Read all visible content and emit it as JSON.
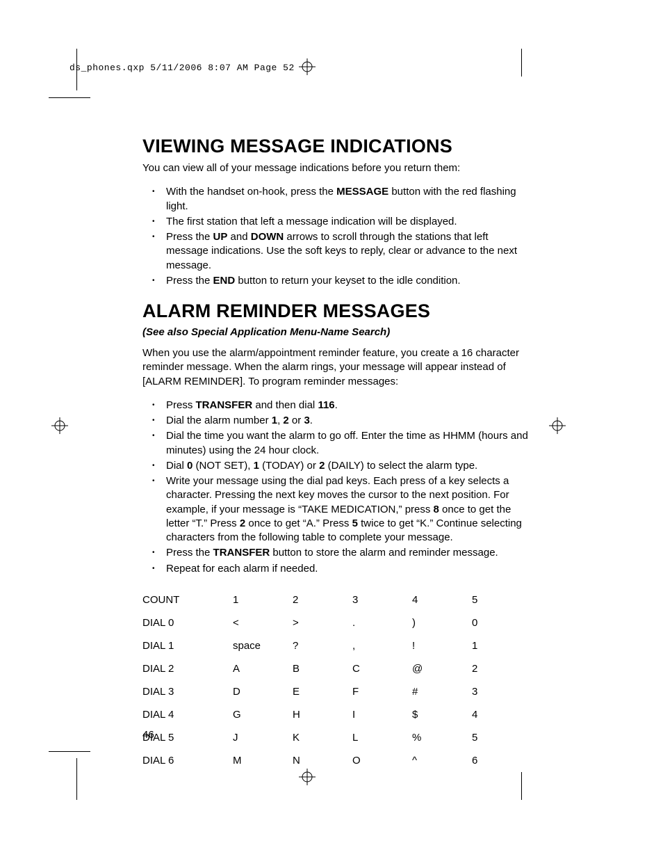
{
  "header_line": "ds_phones.qxp  5/11/2006  8:07 AM  Page 52",
  "section1": {
    "title": "VIEWING MESSAGE INDICATIONS",
    "intro": "You can view all of your message indications before you return them:",
    "bullets": [
      {
        "pre": "With the handset on-hook, press the ",
        "b1": "MESSAGE",
        "post": " button with the red flashing light."
      },
      {
        "pre": "The first station that left a message indication will be displayed."
      },
      {
        "pre": "Press the ",
        "b1": "UP",
        "mid1": " and ",
        "b2": "DOWN",
        "post": " arrows to scroll through the stations that left message indications. Use the soft keys to reply, clear or advance to the next message."
      },
      {
        "pre": "Press the ",
        "b1": "END",
        "post": " button to return your keyset to the idle condition."
      }
    ]
  },
  "section2": {
    "title": "ALARM REMINDER MESSAGES",
    "subhead": "(See also Special Application Menu-Name Search)",
    "para": "When you use the alarm/appointment reminder feature, you  create a 16 character reminder message. When the alarm rings, your message will appear instead of [ALARM REMINDER]. To program reminder messages:",
    "bullets": [
      {
        "pre": "Press ",
        "b1": "TRANSFER",
        "mid1": " and then dial ",
        "b2": "116",
        "post": "."
      },
      {
        "pre": "Dial the alarm number ",
        "b1": "1",
        "mid1": ", ",
        "b2": "2",
        "mid2": " or ",
        "b3": "3",
        "post": "."
      },
      {
        "pre": "Dial the time you want the alarm to go off. Enter the time as HHMM (hours and minutes) using the 24 hour clock."
      },
      {
        "pre": "Dial ",
        "b1": "0",
        "mid1": " (NOT SET), ",
        "b2": "1",
        "mid2": " (TODAY) or ",
        "b3": "2",
        "post": " (DAILY) to select the alarm type."
      },
      {
        "pre": "Write your message using the dial pad keys. Each press of a key selects a character. Pressing the next key moves the cursor to the next position. For example, if your message is “TAKE MEDICATION,” press ",
        "b1": "8",
        "mid1": " once to get the letter “T.” Press ",
        "b2": "2",
        "mid2": " once to get “A.” Press ",
        "b3": "5",
        "post": " twice to get “K.” Continue selecting characters from the following table to complete your message."
      },
      {
        "pre": "Press the ",
        "b1": "TRANSFER",
        "post": " button to store the alarm and reminder message."
      },
      {
        "pre": "Repeat for each alarm if needed."
      }
    ]
  },
  "chart_data": {
    "type": "table",
    "headers": [
      "COUNT",
      "1",
      "2",
      "3",
      "4",
      "5"
    ],
    "rows": [
      [
        "DIAL 0",
        "<",
        ">",
        ".",
        ")",
        "0"
      ],
      [
        "DIAL 1",
        "space",
        "?",
        ",",
        "!",
        "1"
      ],
      [
        "DIAL 2",
        "A",
        "B",
        "C",
        "@",
        "2"
      ],
      [
        "DIAL 3",
        "D",
        "E",
        "F",
        "#",
        "3"
      ],
      [
        "DIAL 4",
        "G",
        "H",
        "I",
        "$",
        "4"
      ],
      [
        "DIAL 5",
        "J",
        "K",
        "L",
        "%",
        "5"
      ],
      [
        "DIAL 6",
        "M",
        "N",
        "O",
        "^",
        "6"
      ]
    ]
  },
  "page_number": "46"
}
